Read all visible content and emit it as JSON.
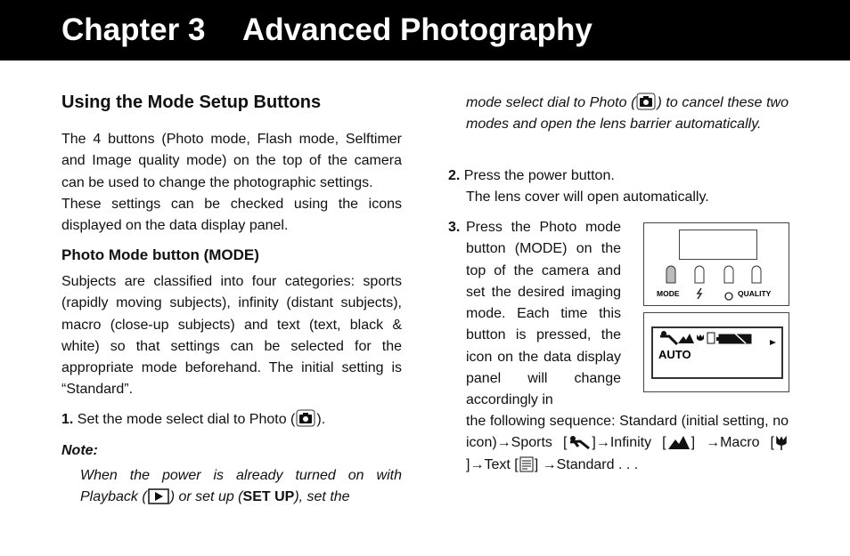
{
  "header": {
    "chapter": "Chapter 3",
    "title": "Advanced Photography"
  },
  "left": {
    "heading": "Using the Mode Setup Buttons",
    "intro1": "The 4 buttons (Photo mode, Flash mode, Selftimer and Image quality mode) on the top of the camera can be used to change the photographic settings.",
    "intro2": "These settings can be checked using the icons displayed on the data display panel.",
    "subheading": "Photo Mode button (MODE)",
    "body": "Subjects are classified into four categories: sports (rapidly moving subjects), infinity (distant subjects), macro (close-up subjects) and text (text, black & white) so that settings can be selected for the appropriate mode beforehand. The initial setting is “Standard”.",
    "step1_num": "1.",
    "step1_a": "Set the mode select dial to Photo (",
    "step1_b": ").",
    "note_label": "Note:",
    "note_a": "When the power is already turned on with Playback (",
    "note_b": ") or set up (",
    "note_setup": "SET UP",
    "note_c": "), set the"
  },
  "right": {
    "note_cont_a": "mode select dial to Photo (",
    "note_cont_b": ") to cancel these two modes and open the lens barrier automatically.",
    "step2_num": "2.",
    "step2": "Press the power button.",
    "step2_sub": "The lens cover will open automatically.",
    "step3_num": "3.",
    "step3": "Press the Photo mode button (MODE) on the top of the camera and set the desired imaging mode. Each time this button is pressed, the icon on the data display panel will change accordingly in",
    "seq_a": "the following sequence: Standard (initial setting, no icon)→Sports [",
    "seq_b": "]→Infinity [",
    "seq_c": "] →Macro [",
    "seq_d": "]→Text [",
    "seq_e": "] →Standard . . .",
    "figure": {
      "labels": [
        "MODE",
        "QUALITY"
      ],
      "panel_text": "AUTO"
    }
  }
}
